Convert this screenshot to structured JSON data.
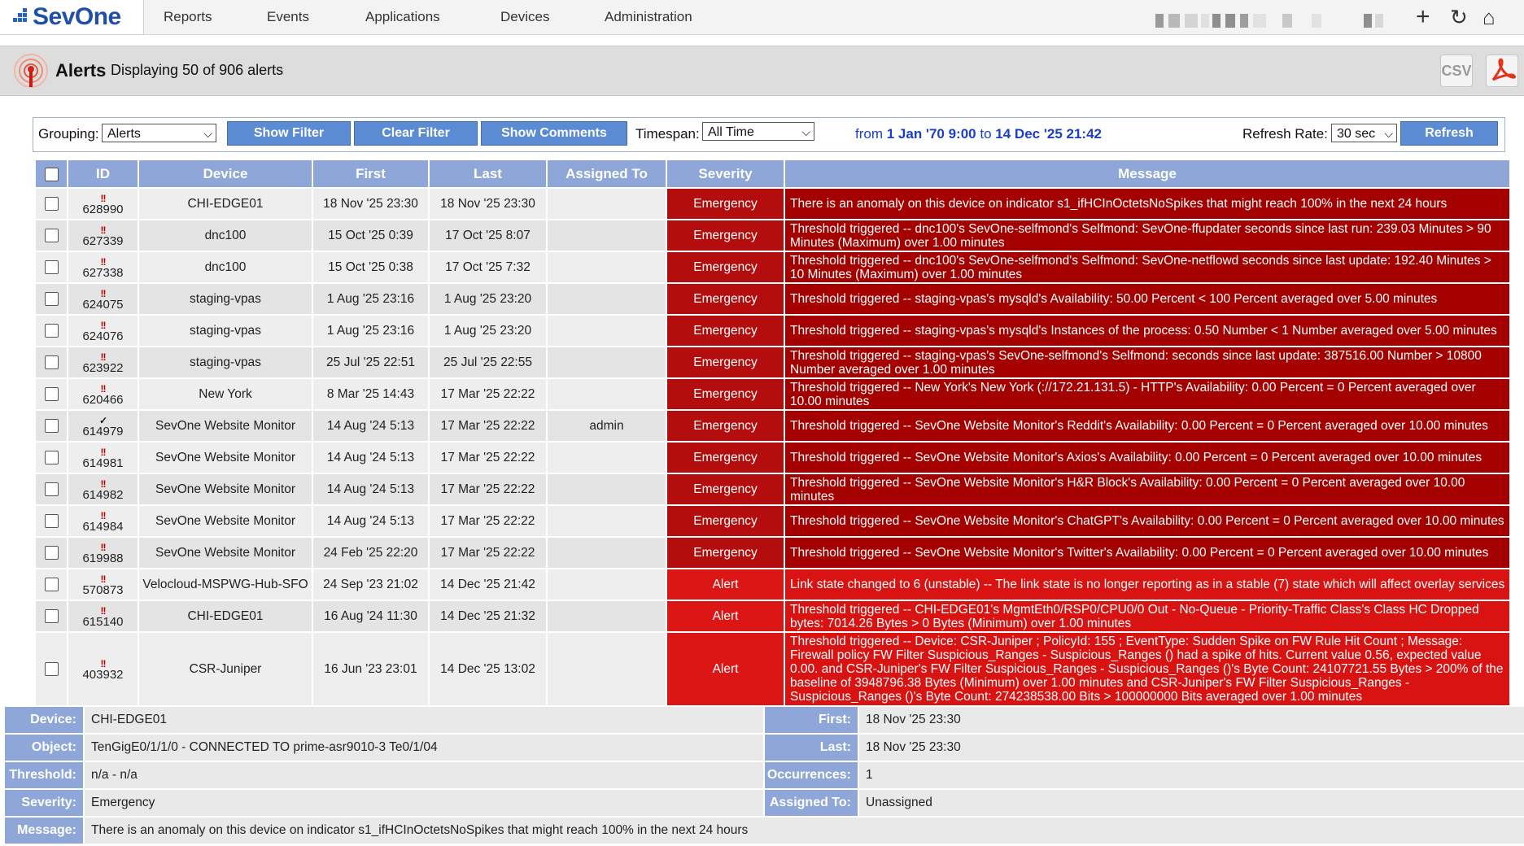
{
  "brand": {
    "name": "SevOne"
  },
  "nav": {
    "items": [
      "Reports",
      "Events",
      "Applications",
      "Devices",
      "Administration"
    ],
    "icons": [
      "plus-icon",
      "refresh-icon",
      "home-icon"
    ]
  },
  "header": {
    "title": "Alerts",
    "subtitle": "Displaying 50 of 906 alerts",
    "csv_label": "CSV"
  },
  "filters": {
    "grouping_label": "Grouping:",
    "grouping_value": "Alerts",
    "show_filter": "Show Filter",
    "clear_filter": "Clear Filter",
    "show_comments": "Show Comments",
    "timespan_label": "Timespan:",
    "timespan_value": "All Time",
    "from_word": "from",
    "from_date": "1 Jan '70 9:00",
    "to_word": "to",
    "to_date": "14 Dec '25 21:42",
    "refresh_rate_label": "Refresh Rate:",
    "refresh_rate_value": "30 sec",
    "refresh_button": "Refresh"
  },
  "table": {
    "columns": [
      "ID",
      "Device",
      "First",
      "Last",
      "Assigned To",
      "Severity",
      "Message"
    ],
    "rows": [
      {
        "id": "628990",
        "icon": "!!",
        "device": "CHI-EDGE01",
        "first": "18 Nov '25 23:30",
        "last": "18 Nov '25 23:30",
        "assigned": "",
        "severity": "Emergency",
        "message": "There is an anomaly on this device on indicator s1_ifHCInOctetsNoSpikes that might reach 100% in the next 24 hours"
      },
      {
        "id": "627339",
        "icon": "!!",
        "device": "dnc100",
        "first": "15 Oct '25 0:39",
        "last": "17 Oct '25 8:07",
        "assigned": "",
        "severity": "Emergency",
        "message": "Threshold triggered -- dnc100's SevOne-selfmond's Selfmond: SevOne-ffupdater seconds since last run: 239.03 Minutes > 90 Minutes (Maximum) over 1.00 minutes"
      },
      {
        "id": "627338",
        "icon": "!!",
        "device": "dnc100",
        "first": "15 Oct '25 0:38",
        "last": "17 Oct '25 7:32",
        "assigned": "",
        "severity": "Emergency",
        "message": "Threshold triggered -- dnc100's SevOne-selfmond's Selfmond: SevOne-netflowd seconds since last update: 192.40 Minutes > 10 Minutes (Maximum) over 1.00 minutes"
      },
      {
        "id": "624075",
        "icon": "!!",
        "device": "staging-vpas",
        "first": "1 Aug '25 23:16",
        "last": "1 Aug '25 23:20",
        "assigned": "",
        "severity": "Emergency",
        "message": "Threshold triggered -- staging-vpas's mysqld's Availability: 50.00 Percent < 100 Percent averaged over 5.00 minutes"
      },
      {
        "id": "624076",
        "icon": "!!",
        "device": "staging-vpas",
        "first": "1 Aug '25 23:16",
        "last": "1 Aug '25 23:20",
        "assigned": "",
        "severity": "Emergency",
        "message": "Threshold triggered -- staging-vpas's mysqld's Instances of the process: 0.50 Number < 1 Number averaged over 5.00 minutes"
      },
      {
        "id": "623922",
        "icon": "!!",
        "device": "staging-vpas",
        "first": "25 Jul '25 22:51",
        "last": "25 Jul '25 22:55",
        "assigned": "",
        "severity": "Emergency",
        "message": "Threshold triggered -- staging-vpas's SevOne-selfmond's Selfmond: seconds since last update: 387516.00 Number > 10800 Number averaged over 1.00 minutes"
      },
      {
        "id": "620466",
        "icon": "!!",
        "device": "New York",
        "first": "8 Mar '25 14:43",
        "last": "17 Mar '25 22:22",
        "assigned": "",
        "severity": "Emergency",
        "message": "Threshold triggered -- New York's New York (://172.21.131.5) - HTTP's Availability: 0.00 Percent = 0 Percent averaged over 10.00 minutes"
      },
      {
        "id": "614979",
        "icon": "✓",
        "device": "SevOne Website Monitor",
        "first": "14 Aug '24 5:13",
        "last": "17 Mar '25 22:22",
        "assigned": "admin",
        "severity": "Emergency",
        "message": "Threshold triggered -- SevOne Website Monitor's Reddit's Availability: 0.00 Percent = 0 Percent averaged over 10.00 minutes"
      },
      {
        "id": "614981",
        "icon": "!!",
        "device": "SevOne Website Monitor",
        "first": "14 Aug '24 5:13",
        "last": "17 Mar '25 22:22",
        "assigned": "",
        "severity": "Emergency",
        "message": "Threshold triggered -- SevOne Website Monitor's Axios's Availability: 0.00 Percent = 0 Percent averaged over 10.00 minutes"
      },
      {
        "id": "614982",
        "icon": "!!",
        "device": "SevOne Website Monitor",
        "first": "14 Aug '24 5:13",
        "last": "17 Mar '25 22:22",
        "assigned": "",
        "severity": "Emergency",
        "message": "Threshold triggered -- SevOne Website Monitor's H&R Block's Availability: 0.00 Percent = 0 Percent averaged over 10.00 minutes"
      },
      {
        "id": "614984",
        "icon": "!!",
        "device": "SevOne Website Monitor",
        "first": "14 Aug '24 5:13",
        "last": "17 Mar '25 22:22",
        "assigned": "",
        "severity": "Emergency",
        "message": "Threshold triggered -- SevOne Website Monitor's ChatGPT's Availability: 0.00 Percent = 0 Percent averaged over 10.00 minutes"
      },
      {
        "id": "619988",
        "icon": "!!",
        "device": "SevOne Website Monitor",
        "first": "24 Feb '25 22:20",
        "last": "17 Mar '25 22:22",
        "assigned": "",
        "severity": "Emergency",
        "message": "Threshold triggered -- SevOne Website Monitor's Twitter's Availability: 0.00 Percent = 0 Percent averaged over 10.00 minutes"
      },
      {
        "id": "570873",
        "icon": "!!",
        "device": "Velocloud-MSPWG-Hub-SFO",
        "first": "24 Sep '23 21:02",
        "last": "14 Dec '25 21:42",
        "assigned": "",
        "severity": "Alert",
        "message": "Link state changed to 6 (unstable) -- The link state is no longer reporting as in a stable (7) state which will affect overlay services"
      },
      {
        "id": "615140",
        "icon": "!!",
        "device": "CHI-EDGE01",
        "first": "16 Aug '24 11:30",
        "last": "14 Dec '25 21:32",
        "assigned": "",
        "severity": "Alert",
        "message": "Threshold triggered -- CHI-EDGE01's MgmtEth0/RSP0/CPU0/0 Out - No-Queue - Priority-Traffic Class's Class HC Dropped bytes: 7014.26 Bytes > 0 Bytes (Minimum) over 1.00 minutes"
      },
      {
        "id": "403932",
        "icon": "!!",
        "device": "CSR-Juniper",
        "first": "16 Jun '23 23:01",
        "last": "14 Dec '25 13:02",
        "assigned": "",
        "severity": "Alert",
        "message": "Threshold triggered -- Device: CSR-Juniper ; PolicyId: 155 ; EventType: Sudden Spike on FW Rule Hit Count ; Message: Firewall policy FW Filter Suspicious_Ranges - Suspicious_Ranges () had a spike of hits. Current value 0.56, expected value 0.00. and CSR-Juniper's FW Filter Suspicious_Ranges - Suspicious_Ranges ()'s Byte Count: 24107721.55 Bytes > 200% of the baseline of 3948796.38 Bytes (Minimum) over 1.00 minutes and CSR-Juniper's FW Filter Suspicious_Ranges - Suspicious_Ranges ()'s Byte Count: 274238538.00 Bits > 100000000 Bits averaged over 1.00 minutes"
      }
    ]
  },
  "details": {
    "device_label": "Device:",
    "device": "CHI-EDGE01",
    "object_label": "Object:",
    "object": "TenGigE0/1/1/0 - CONNECTED TO prime-asr9010-3 Te0/1/04",
    "threshold_label": "Threshold:",
    "threshold": "n/a - n/a",
    "severity_label": "Severity:",
    "severity": "Emergency",
    "message_label": "Message:",
    "message": "There is an anomaly on this device on indicator s1_ifHCInOctetsNoSpikes that might reach 100% in the next 24 hours",
    "first_label": "First:",
    "first": "18 Nov '25 23:30",
    "last_label": "Last:",
    "last": "18 Nov '25 23:30",
    "occurrences_label": "Occurrences:",
    "occurrences": "1",
    "assigned_label": "Assigned To:",
    "assigned": "Unassigned"
  },
  "colors": {
    "header_blue": "#8ea6d8",
    "emergency_red": "#a50000",
    "alert_red": "#d91212",
    "button_blue": "#5b8bd3"
  }
}
